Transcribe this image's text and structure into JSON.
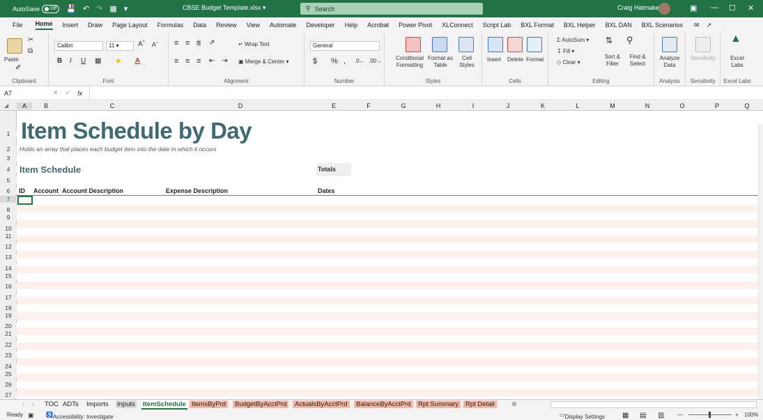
{
  "titlebar": {
    "autosave_label": "AutoSave",
    "autosave_state": "Off",
    "filename": "CBSE Budget Template.xlsx",
    "search_placeholder": "Search",
    "user": "Craig Hatmaker"
  },
  "menu": {
    "items": [
      "File",
      "Home",
      "Insert",
      "Draw",
      "Page Layout",
      "Formulas",
      "Data",
      "Review",
      "View",
      "Automate",
      "Developer",
      "Help",
      "Acrobat",
      "Power Pivot",
      "XLConnect",
      "Script Lab",
      "BXL Format",
      "BXL Helper",
      "BXL DAN",
      "BXL Scenarios"
    ],
    "active": "Home"
  },
  "ribbon": {
    "paste": "Paste",
    "font_name": "Calibri",
    "font_size": "11",
    "wrap_text": "Wrap Text",
    "merge_center": "Merge & Center",
    "number_format": "General",
    "conditional_formatting": "Conditional Formatting",
    "format_as_table": "Format as Table",
    "cell_styles": "Cell Styles",
    "insert": "Insert",
    "delete": "Delete",
    "format": "Format",
    "autosum": "AutoSum",
    "fill": "Fill",
    "clear": "Clear",
    "sort_filter": "Sort & Filter",
    "find_select": "Find & Select",
    "analyze_data": "Analyze Data",
    "sensitivity": "Sensitivity",
    "excel_labs": "Excel Labs",
    "groups": {
      "clipboard": "Clipboard",
      "font": "Font",
      "alignment": "Alignment",
      "number": "Number",
      "styles": "Styles",
      "cells": "Cells",
      "editing": "Editing",
      "analysis": "Analysis",
      "sensitivity": "Sensitivity",
      "excel_labs": "Excel Labs"
    }
  },
  "formula_bar": {
    "name_box": "A7",
    "fx": "fx",
    "formula": ""
  },
  "columns": [
    "A",
    "B",
    "C",
    "D",
    "E",
    "F",
    "G",
    "H",
    "I",
    "J",
    "K",
    "L",
    "M",
    "N",
    "O",
    "P",
    "Q"
  ],
  "sheet": {
    "title": "Item Schedule by Day",
    "subtitle": "Holds an array that places each budget item into the date in which it occurs",
    "section_heading": "Item Schedule",
    "totals_label": "Totals",
    "headers": {
      "id": "ID",
      "account": "Account",
      "account_description": "Account Description",
      "expense_description": "Expense Description",
      "dates": "Dates"
    },
    "row_numbers": [
      "1",
      "2",
      "3",
      "4",
      "5",
      "6",
      "7",
      "8",
      "9",
      "10",
      "11",
      "12",
      "13",
      "14",
      "15",
      "16",
      "17",
      "18",
      "19",
      "20",
      "21",
      "22",
      "23",
      "24",
      "25",
      "26",
      "27"
    ]
  },
  "tabs": {
    "items": [
      "TOC",
      "ADTs",
      "Imports",
      "Inputs",
      "ItemSchedule",
      "ItemsByPrd",
      "BudgetByAcctPrd",
      "ActualsByAcctPrd",
      "BalanceByAcctPrd",
      "Rpt Summary",
      "Rpt Detail"
    ],
    "active": "ItemSchedule"
  },
  "status": {
    "ready": "Ready",
    "accessibility": "Accessibility: Investigate",
    "display_settings": "Display Settings",
    "zoom": "100%"
  },
  "colors": {
    "excel_green": "#217346",
    "title_teal": "#3f6a72",
    "band_pink": "#fdf1ee",
    "tab_salmon": "#f4b6a6",
    "tab_gray": "#d9d9d9"
  }
}
